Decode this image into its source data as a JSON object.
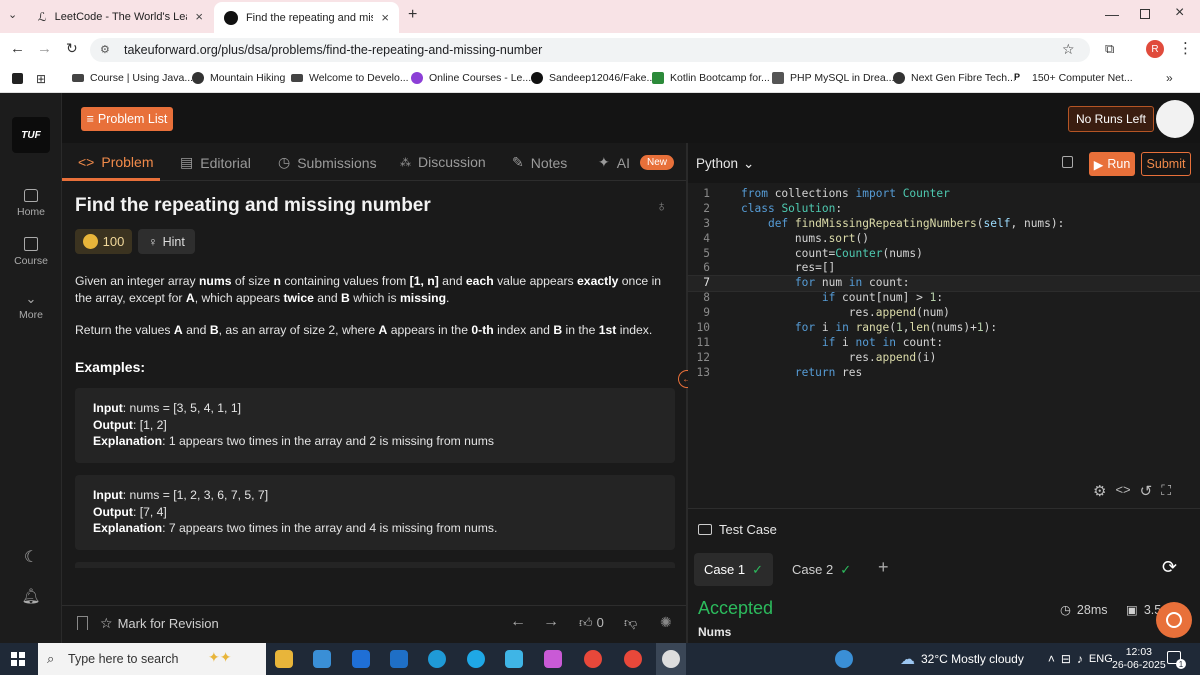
{
  "browser": {
    "tabs": [
      {
        "title": "LeetCode - The World's Leading"
      },
      {
        "title": "Find the repeating and missing"
      }
    ],
    "url": "takeuforward.org/plus/dsa/problems/find-the-repeating-and-missing-number",
    "profile_initial": "R",
    "bookmarks": [
      {
        "label": "Course | Using Java..."
      },
      {
        "label": "Mountain Hiking"
      },
      {
        "label": "Welcome to Develo..."
      },
      {
        "label": "Online Courses - Le..."
      },
      {
        "label": "Sandeep12046/Fake..."
      },
      {
        "label": "Kotlin Bootcamp for..."
      },
      {
        "label": "PHP MySQL in Drea..."
      },
      {
        "label": "Next Gen Fibre Tech..."
      },
      {
        "label": "150+ Computer Net..."
      }
    ]
  },
  "sidebar": {
    "logo": "TUF",
    "items": [
      {
        "label": "Home"
      },
      {
        "label": "Course"
      },
      {
        "label": "More"
      }
    ]
  },
  "header": {
    "problem_list": "Problem List",
    "no_runs": "No Runs Left"
  },
  "problem_tabs": [
    {
      "label": "Problem"
    },
    {
      "label": "Editorial"
    },
    {
      "label": "Submissions"
    },
    {
      "label": "Discussion"
    },
    {
      "label": "Notes"
    },
    {
      "label": "AI"
    }
  ],
  "new_badge": "New",
  "problem": {
    "title": "Find the repeating and missing number",
    "coins": "100",
    "hint": "Hint",
    "examples_heading": "Examples:",
    "examples": [
      {
        "input_label": "Input",
        "input": ": nums = [3, 5, 4, 1, 1]",
        "output_label": "Output",
        "output": ": [1, 2]",
        "explanation_label": "Explanation",
        "explanation": ": 1 appears two times in the array and 2 is missing from nums"
      },
      {
        "input_label": "Input",
        "input": ": nums = [1, 2, 3, 6, 7, 5, 7]",
        "output_label": "Output",
        "output": ": [7, 4]",
        "explanation_label": "Explanation",
        "explanation": ": 7 appears two times in the array and 4 is missing from nums."
      }
    ]
  },
  "footer": {
    "mark_revision": "Mark for Revision",
    "likes": "0"
  },
  "editor": {
    "language": "Python",
    "run": "Run",
    "submit": "Submit",
    "current_line": 7
  },
  "testcase": {
    "title": "Test Case",
    "cases": [
      {
        "label": "Case 1"
      },
      {
        "label": "Case 2"
      }
    ],
    "status": "Accepted",
    "input_name": "Nums",
    "runtime": "28ms",
    "memory": "3.5"
  },
  "taskbar": {
    "search_placeholder": "Type here to search",
    "weather": "32°C  Mostly cloudy",
    "lang": "ENG",
    "time": "12:03",
    "date": "26-06-2025",
    "notifications": "1"
  }
}
